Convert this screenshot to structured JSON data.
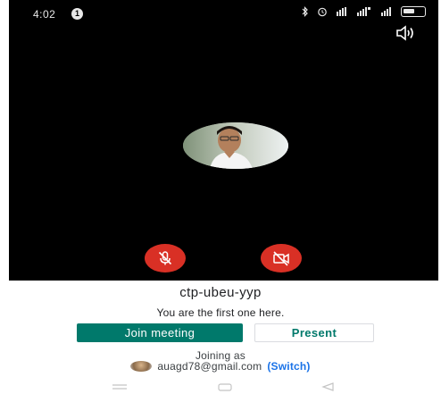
{
  "status_bar": {
    "time": "4:02",
    "notification_count": "1",
    "icons": [
      "bluetooth-icon",
      "alarm-icon",
      "vibrate-icon",
      "signal-icon",
      "wifi-icon",
      "battery-icon"
    ]
  },
  "preview": {
    "background": "#000000",
    "speaker_icon": "speaker-icon"
  },
  "controls": {
    "mic_icon": "mic-off-icon",
    "camera_icon": "camera-off-icon",
    "button_color": "#d93025"
  },
  "meeting": {
    "code": "ctp-ubeu-yyp",
    "message": "You are the first one here."
  },
  "actions": {
    "join_label": "Join meeting",
    "present_label": "Present",
    "accent": "#00796b"
  },
  "account": {
    "joining_as_label": "Joining as",
    "email": "auagd78@gmail.com",
    "switch_label": "(Switch)",
    "link_color": "#1a73e8"
  },
  "nav": {
    "icons": [
      "recents-icon",
      "home-icon",
      "back-icon"
    ]
  }
}
